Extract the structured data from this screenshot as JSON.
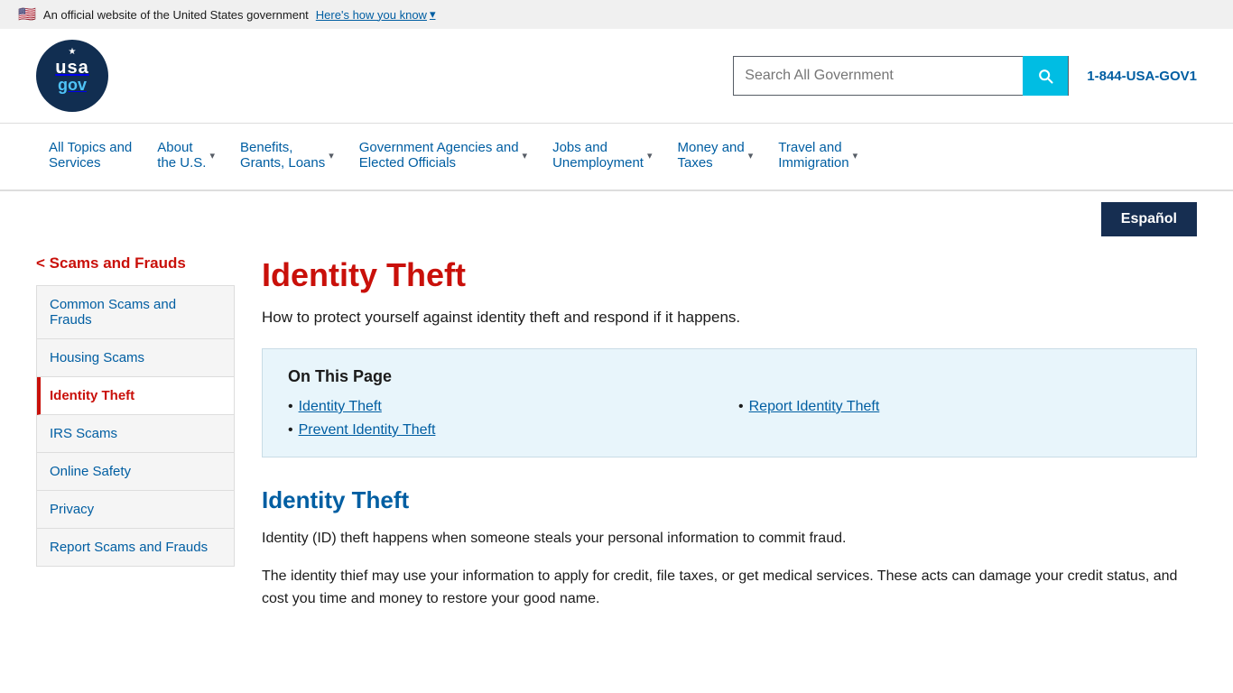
{
  "govBanner": {
    "flagEmoji": "🇺🇸",
    "officialText": "An official website of the United States government",
    "howToKnowText": "Here's how you know",
    "chevron": "▾"
  },
  "header": {
    "logoLine1": "usa",
    "logoLine2": "gov",
    "searchPlaceholder": "Search All Government",
    "searchBtnLabel": "Search",
    "phoneNumber": "1-844-USA-GOV1"
  },
  "nav": {
    "items": [
      {
        "label": "All Topics and\nServices",
        "hasDropdown": false,
        "active": false
      },
      {
        "label": "About\nthe U.S.",
        "hasDropdown": true,
        "active": false
      },
      {
        "label": "Benefits,\nGrants, Loans",
        "hasDropdown": true,
        "active": false
      },
      {
        "label": "Government Agencies and\nElected Officials",
        "hasDropdown": true,
        "active": false
      },
      {
        "label": "Jobs and\nUnemployment",
        "hasDropdown": true,
        "active": false
      },
      {
        "label": "Money and\nTaxes",
        "hasDropdown": true,
        "active": false
      },
      {
        "label": "Travel and\nImmigration",
        "hasDropdown": true,
        "active": false
      }
    ]
  },
  "langButton": "Español",
  "sidebar": {
    "parentLabel": "< Scams and Frauds",
    "items": [
      {
        "label": "Common Scams and Frauds",
        "active": false
      },
      {
        "label": "Housing Scams",
        "active": false
      },
      {
        "label": "Identity Theft",
        "active": true
      },
      {
        "label": "IRS Scams",
        "active": false
      },
      {
        "label": "Online Safety",
        "active": false
      },
      {
        "label": "Privacy",
        "active": false
      },
      {
        "label": "Report Scams and Frauds",
        "active": false
      }
    ]
  },
  "mainContent": {
    "pageTitle": "Identity Theft",
    "subtitle": "How to protect yourself against identity theft and respond if it happens.",
    "onThisPage": {
      "heading": "On This Page",
      "links": [
        {
          "label": "Identity Theft",
          "position": "col1"
        },
        {
          "label": "Report Identity Theft",
          "position": "col2"
        },
        {
          "label": "Prevent Identity Theft",
          "position": "col1"
        }
      ]
    },
    "section1": {
      "heading": "Identity Theft",
      "para1": "Identity (ID) theft happens when someone steals your personal information to commit fraud.",
      "para2": "The identity thief may use your information to apply for credit, file taxes, or get medical services. These acts can damage your credit status, and cost you time and money to restore your good name."
    }
  }
}
